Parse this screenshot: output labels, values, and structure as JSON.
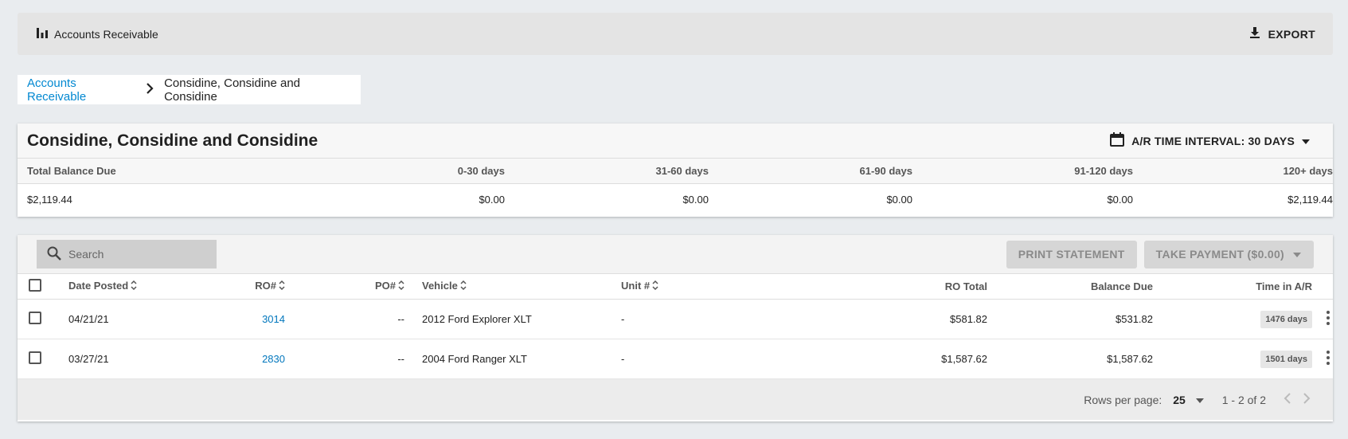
{
  "topbar": {
    "icon": "bar-chart-icon",
    "title": "Accounts Receivable",
    "export_label": "EXPORT",
    "export_icon": "download-icon"
  },
  "breadcrumb": {
    "root": "Accounts Receivable",
    "current": "Considine, Considine and Considine"
  },
  "summary": {
    "title": "Considine, Considine and Considine",
    "interval_label": "A/R TIME INTERVAL: 30 DAYS",
    "columns": [
      "Total Balance Due",
      "0-30 days",
      "31-60 days",
      "61-90 days",
      "91-120 days",
      "120+ days"
    ],
    "values": [
      "$2,119.44",
      "$0.00",
      "$0.00",
      "$0.00",
      "$0.00",
      "$2,119.44"
    ]
  },
  "toolbar": {
    "search_placeholder": "Search",
    "print_label": "PRINT STATEMENT",
    "payment_label": "TAKE PAYMENT ($0.00)"
  },
  "table": {
    "headers": {
      "date_posted": "Date Posted",
      "ro": "RO#",
      "po": "PO#",
      "vehicle": "Vehicle",
      "unit": "Unit #",
      "ro_total": "RO Total",
      "balance_due": "Balance Due",
      "time_in_ar": "Time in A/R"
    },
    "rows": [
      {
        "date_posted": "04/21/21",
        "ro": "3014",
        "po": "--",
        "vehicle": "2012 Ford Explorer XLT",
        "unit": "-",
        "ro_total": "$581.82",
        "balance_due": "$531.82",
        "time_in_ar": "1476 days"
      },
      {
        "date_posted": "03/27/21",
        "ro": "2830",
        "po": "--",
        "vehicle": "2004 Ford Ranger XLT",
        "unit": "-",
        "ro_total": "$1,587.62",
        "balance_due": "$1,587.62",
        "time_in_ar": "1501 days"
      }
    ]
  },
  "footer": {
    "rows_per_page_label": "Rows per page:",
    "rows_per_page_value": "25",
    "range": "1 - 2 of 2"
  },
  "colors": {
    "link": "#0288d1",
    "background": "#e9ecef"
  }
}
